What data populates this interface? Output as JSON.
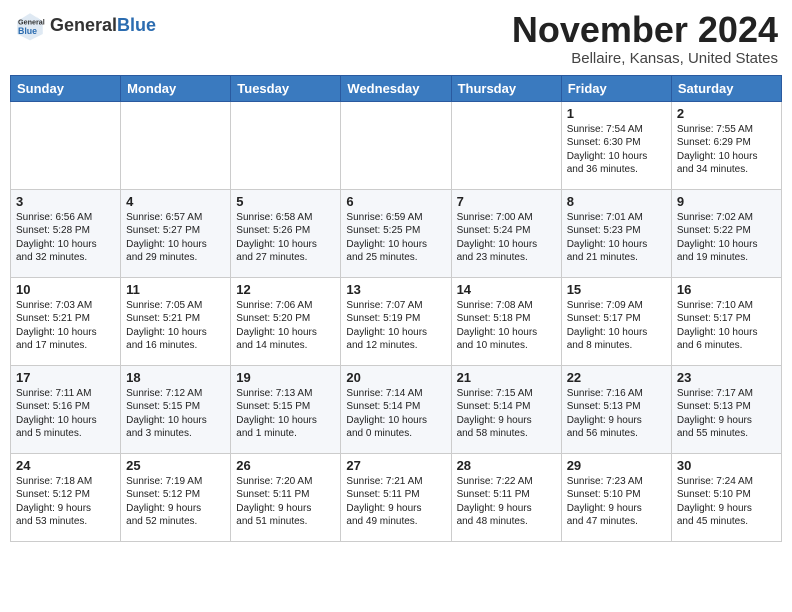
{
  "header": {
    "logo_general": "General",
    "logo_blue": "Blue",
    "month": "November 2024",
    "location": "Bellaire, Kansas, United States"
  },
  "days_of_week": [
    "Sunday",
    "Monday",
    "Tuesday",
    "Wednesday",
    "Thursday",
    "Friday",
    "Saturday"
  ],
  "weeks": [
    [
      {
        "day": "",
        "info": ""
      },
      {
        "day": "",
        "info": ""
      },
      {
        "day": "",
        "info": ""
      },
      {
        "day": "",
        "info": ""
      },
      {
        "day": "",
        "info": ""
      },
      {
        "day": "1",
        "info": "Sunrise: 7:54 AM\nSunset: 6:30 PM\nDaylight: 10 hours\nand 36 minutes."
      },
      {
        "day": "2",
        "info": "Sunrise: 7:55 AM\nSunset: 6:29 PM\nDaylight: 10 hours\nand 34 minutes."
      }
    ],
    [
      {
        "day": "3",
        "info": "Sunrise: 6:56 AM\nSunset: 5:28 PM\nDaylight: 10 hours\nand 32 minutes."
      },
      {
        "day": "4",
        "info": "Sunrise: 6:57 AM\nSunset: 5:27 PM\nDaylight: 10 hours\nand 29 minutes."
      },
      {
        "day": "5",
        "info": "Sunrise: 6:58 AM\nSunset: 5:26 PM\nDaylight: 10 hours\nand 27 minutes."
      },
      {
        "day": "6",
        "info": "Sunrise: 6:59 AM\nSunset: 5:25 PM\nDaylight: 10 hours\nand 25 minutes."
      },
      {
        "day": "7",
        "info": "Sunrise: 7:00 AM\nSunset: 5:24 PM\nDaylight: 10 hours\nand 23 minutes."
      },
      {
        "day": "8",
        "info": "Sunrise: 7:01 AM\nSunset: 5:23 PM\nDaylight: 10 hours\nand 21 minutes."
      },
      {
        "day": "9",
        "info": "Sunrise: 7:02 AM\nSunset: 5:22 PM\nDaylight: 10 hours\nand 19 minutes."
      }
    ],
    [
      {
        "day": "10",
        "info": "Sunrise: 7:03 AM\nSunset: 5:21 PM\nDaylight: 10 hours\nand 17 minutes."
      },
      {
        "day": "11",
        "info": "Sunrise: 7:05 AM\nSunset: 5:21 PM\nDaylight: 10 hours\nand 16 minutes."
      },
      {
        "day": "12",
        "info": "Sunrise: 7:06 AM\nSunset: 5:20 PM\nDaylight: 10 hours\nand 14 minutes."
      },
      {
        "day": "13",
        "info": "Sunrise: 7:07 AM\nSunset: 5:19 PM\nDaylight: 10 hours\nand 12 minutes."
      },
      {
        "day": "14",
        "info": "Sunrise: 7:08 AM\nSunset: 5:18 PM\nDaylight: 10 hours\nand 10 minutes."
      },
      {
        "day": "15",
        "info": "Sunrise: 7:09 AM\nSunset: 5:17 PM\nDaylight: 10 hours\nand 8 minutes."
      },
      {
        "day": "16",
        "info": "Sunrise: 7:10 AM\nSunset: 5:17 PM\nDaylight: 10 hours\nand 6 minutes."
      }
    ],
    [
      {
        "day": "17",
        "info": "Sunrise: 7:11 AM\nSunset: 5:16 PM\nDaylight: 10 hours\nand 5 minutes."
      },
      {
        "day": "18",
        "info": "Sunrise: 7:12 AM\nSunset: 5:15 PM\nDaylight: 10 hours\nand 3 minutes."
      },
      {
        "day": "19",
        "info": "Sunrise: 7:13 AM\nSunset: 5:15 PM\nDaylight: 10 hours\nand 1 minute."
      },
      {
        "day": "20",
        "info": "Sunrise: 7:14 AM\nSunset: 5:14 PM\nDaylight: 10 hours\nand 0 minutes."
      },
      {
        "day": "21",
        "info": "Sunrise: 7:15 AM\nSunset: 5:14 PM\nDaylight: 9 hours\nand 58 minutes."
      },
      {
        "day": "22",
        "info": "Sunrise: 7:16 AM\nSunset: 5:13 PM\nDaylight: 9 hours\nand 56 minutes."
      },
      {
        "day": "23",
        "info": "Sunrise: 7:17 AM\nSunset: 5:13 PM\nDaylight: 9 hours\nand 55 minutes."
      }
    ],
    [
      {
        "day": "24",
        "info": "Sunrise: 7:18 AM\nSunset: 5:12 PM\nDaylight: 9 hours\nand 53 minutes."
      },
      {
        "day": "25",
        "info": "Sunrise: 7:19 AM\nSunset: 5:12 PM\nDaylight: 9 hours\nand 52 minutes."
      },
      {
        "day": "26",
        "info": "Sunrise: 7:20 AM\nSunset: 5:11 PM\nDaylight: 9 hours\nand 51 minutes."
      },
      {
        "day": "27",
        "info": "Sunrise: 7:21 AM\nSunset: 5:11 PM\nDaylight: 9 hours\nand 49 minutes."
      },
      {
        "day": "28",
        "info": "Sunrise: 7:22 AM\nSunset: 5:11 PM\nDaylight: 9 hours\nand 48 minutes."
      },
      {
        "day": "29",
        "info": "Sunrise: 7:23 AM\nSunset: 5:10 PM\nDaylight: 9 hours\nand 47 minutes."
      },
      {
        "day": "30",
        "info": "Sunrise: 7:24 AM\nSunset: 5:10 PM\nDaylight: 9 hours\nand 45 minutes."
      }
    ]
  ]
}
